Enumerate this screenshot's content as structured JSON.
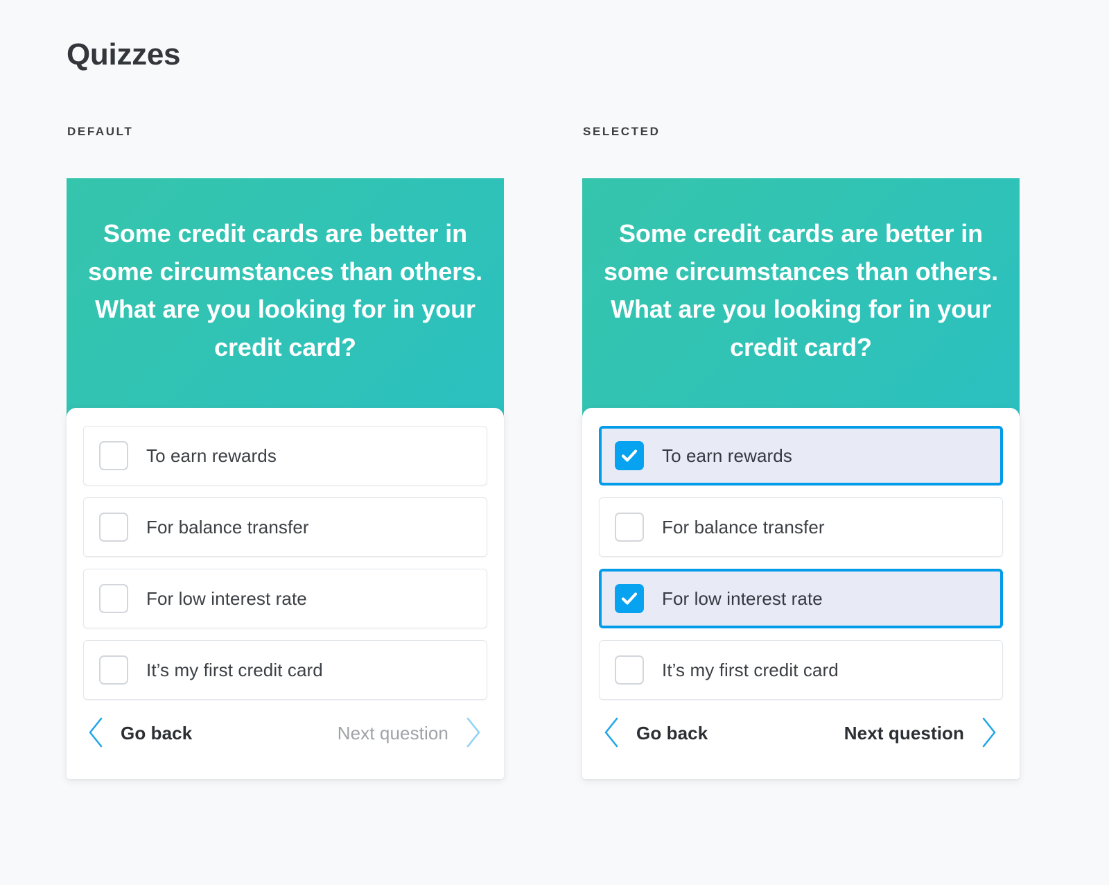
{
  "page": {
    "title": "Quizzes",
    "background_color": "#f8f9fa"
  },
  "colors": {
    "header_gradient_start": "#35c4ac",
    "header_gradient_end": "#2bc0c0",
    "accent_blue": "#039ce8",
    "checkbox_blue": "#07a2f0",
    "selected_row_bg": "#e8eaf6",
    "chevron_blue": "#22a7e8",
    "chevron_blue_light": "#8ed4f5",
    "disabled_text": "#9fa3a8"
  },
  "columns": [
    {
      "label": "DEFAULT",
      "card": {
        "question": "Some credit cards are better in some circumstances than others. What are you looking for in your credit card?",
        "options": [
          {
            "label": "To earn rewards",
            "selected": false
          },
          {
            "label": "For balance transfer",
            "selected": false
          },
          {
            "label": "For low interest rate",
            "selected": false
          },
          {
            "label": "It’s my first credit card",
            "selected": false
          }
        ],
        "nav": {
          "back_label": "Go back",
          "back_enabled": true,
          "next_label": "Next question",
          "next_enabled": false
        }
      }
    },
    {
      "label": "SELECTED",
      "card": {
        "question": "Some credit cards are better in some circumstances than others. What are you looking for in your credit card?",
        "options": [
          {
            "label": "To earn rewards",
            "selected": true
          },
          {
            "label": "For balance transfer",
            "selected": false
          },
          {
            "label": "For low interest rate",
            "selected": true
          },
          {
            "label": "It’s my first credit card",
            "selected": false
          }
        ],
        "nav": {
          "back_label": "Go back",
          "back_enabled": true,
          "next_label": "Next question",
          "next_enabled": true
        }
      }
    }
  ]
}
